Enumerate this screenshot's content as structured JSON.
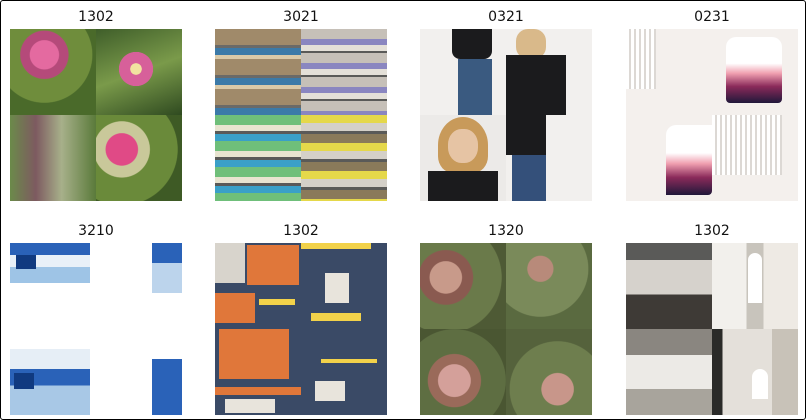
{
  "grid": {
    "cells": [
      {
        "label": "1302",
        "subject": "pink-flower-spikes-image"
      },
      {
        "label": "3021",
        "subject": "store-shelves-image"
      },
      {
        "label": "0321",
        "subject": "woman-fashion-image"
      },
      {
        "label": "0231",
        "subject": "tank-top-product-image"
      },
      {
        "label": "3210",
        "subject": "medicine-packaging-image"
      },
      {
        "label": "1302",
        "subject": "infographic-poster-image"
      },
      {
        "label": "1320",
        "subject": "wild-orchid-image"
      },
      {
        "label": "1302",
        "subject": "church-interior-image"
      }
    ]
  }
}
